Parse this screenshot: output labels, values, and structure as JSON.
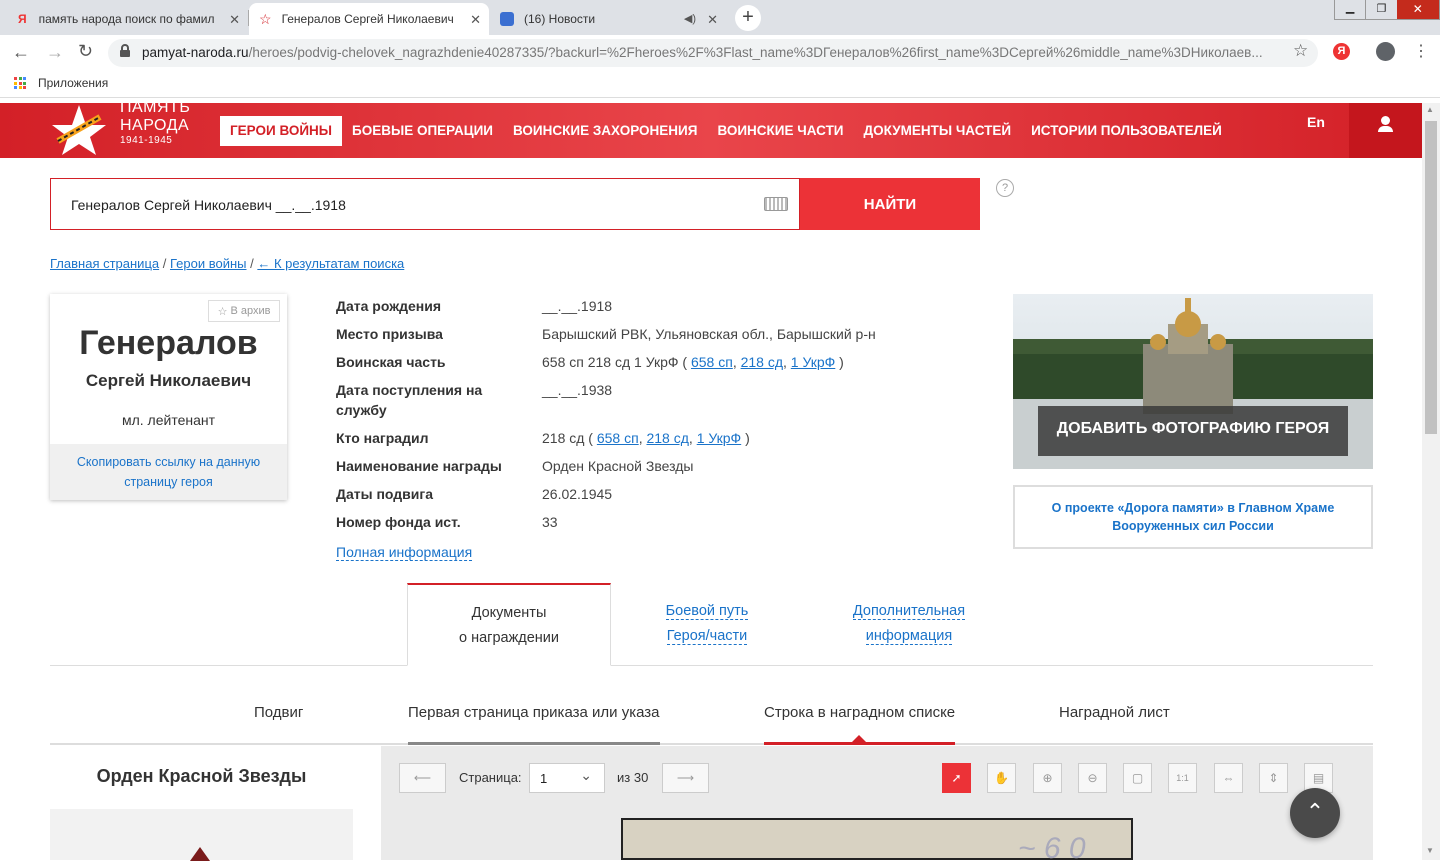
{
  "browser": {
    "tabs": [
      {
        "title": "память народа поиск по фамил"
      },
      {
        "title": "Генералов Сергей Николаевич"
      },
      {
        "title": "(16) Новости"
      }
    ],
    "url_host": "pamyat-naroda.ru",
    "url_path": "/heroes/podvig-chelovek_nagrazhdenie40287335/?backurl=%2Fheroes%2F%3Flast_name%3DГенералов%26first_name%3DСергей%26middle_name%3DНиколаев...",
    "bookmarks_label": "Приложения"
  },
  "site": {
    "logo_line1": "ПАМЯТЬ",
    "logo_line2": "НАРОДА",
    "logo_years": "1941-1945",
    "nav": [
      "ГЕРОИ ВОЙНЫ",
      "БОЕВЫЕ ОПЕРАЦИИ",
      "ВОИНСКИЕ ЗАХОРОНЕНИЯ",
      "ВОИНСКИЕ ЧАСТИ",
      "ДОКУМЕНТЫ ЧАСТЕЙ",
      "ИСТОРИИ ПОЛЬЗОВАТЕЛЕЙ"
    ],
    "lang": "En"
  },
  "search": {
    "value": "Генералов Сергей Николаевич __.__.1918",
    "button": "НАЙТИ",
    "help": "?"
  },
  "breadcrumbs": [
    "Главная страница",
    "Герои войны",
    "← К результатам поиска"
  ],
  "hero": {
    "archive_btn": "В архив",
    "last_name": "Генералов",
    "first_middle": "Сергей Николаевич",
    "rank": "мл. лейтенант",
    "copy_link": "Скопировать ссылку на данную страницу героя"
  },
  "info": {
    "birth_label": "Дата рождения",
    "birth_value": "__.__.1918",
    "draft_label": "Место призыва",
    "draft_value": "Барышский РВК, Ульяновская обл., Барышский р-н",
    "unit_label": "Воинская часть",
    "unit_value": "658 сп 218 сд 1 УкрФ (",
    "unit_links": [
      "658 сп",
      "218 сд",
      "1 УкрФ"
    ],
    "service_label": "Дата поступления на службу",
    "service_value": "__.__.1938",
    "awarded_by_label": "Кто наградил",
    "awarded_by_value": "218 сд (",
    "awarded_by_links": [
      "658 сп",
      "218 сд",
      "1 УкрФ"
    ],
    "award_label": "Наименование награды",
    "award_value": "Орден Красной Звезды",
    "feat_label": "Даты подвига",
    "feat_value": "26.02.1945",
    "fund_label": "Номер фонда ист.",
    "fund_value": "33",
    "full_info": "Полная информация"
  },
  "side": {
    "add_photo": "ДОБАВИТЬ ФОТОГРАФИЮ ГЕРОЯ",
    "project": "О проекте «Дорога памяти» в Главном Храме Вооруженных сил России"
  },
  "doc_tabs": [
    {
      "line1": "Документы",
      "line2": "о награждении"
    },
    {
      "line1": "Боевой путь",
      "line2": "Героя/части"
    },
    {
      "line1": "Дополнительная",
      "line2": "информация"
    }
  ],
  "sub_tabs": [
    "Подвиг",
    "Первая страница приказа или указа",
    "Строка в наградном списке",
    "Наградной лист"
  ],
  "award_title": "Орден Красной Звезды",
  "viewer": {
    "page_label": "Страница:",
    "page_value": "1",
    "of_label": "из 30"
  },
  "colors": {
    "brand_red": "#d32027",
    "link_blue": "#1a73c9"
  }
}
